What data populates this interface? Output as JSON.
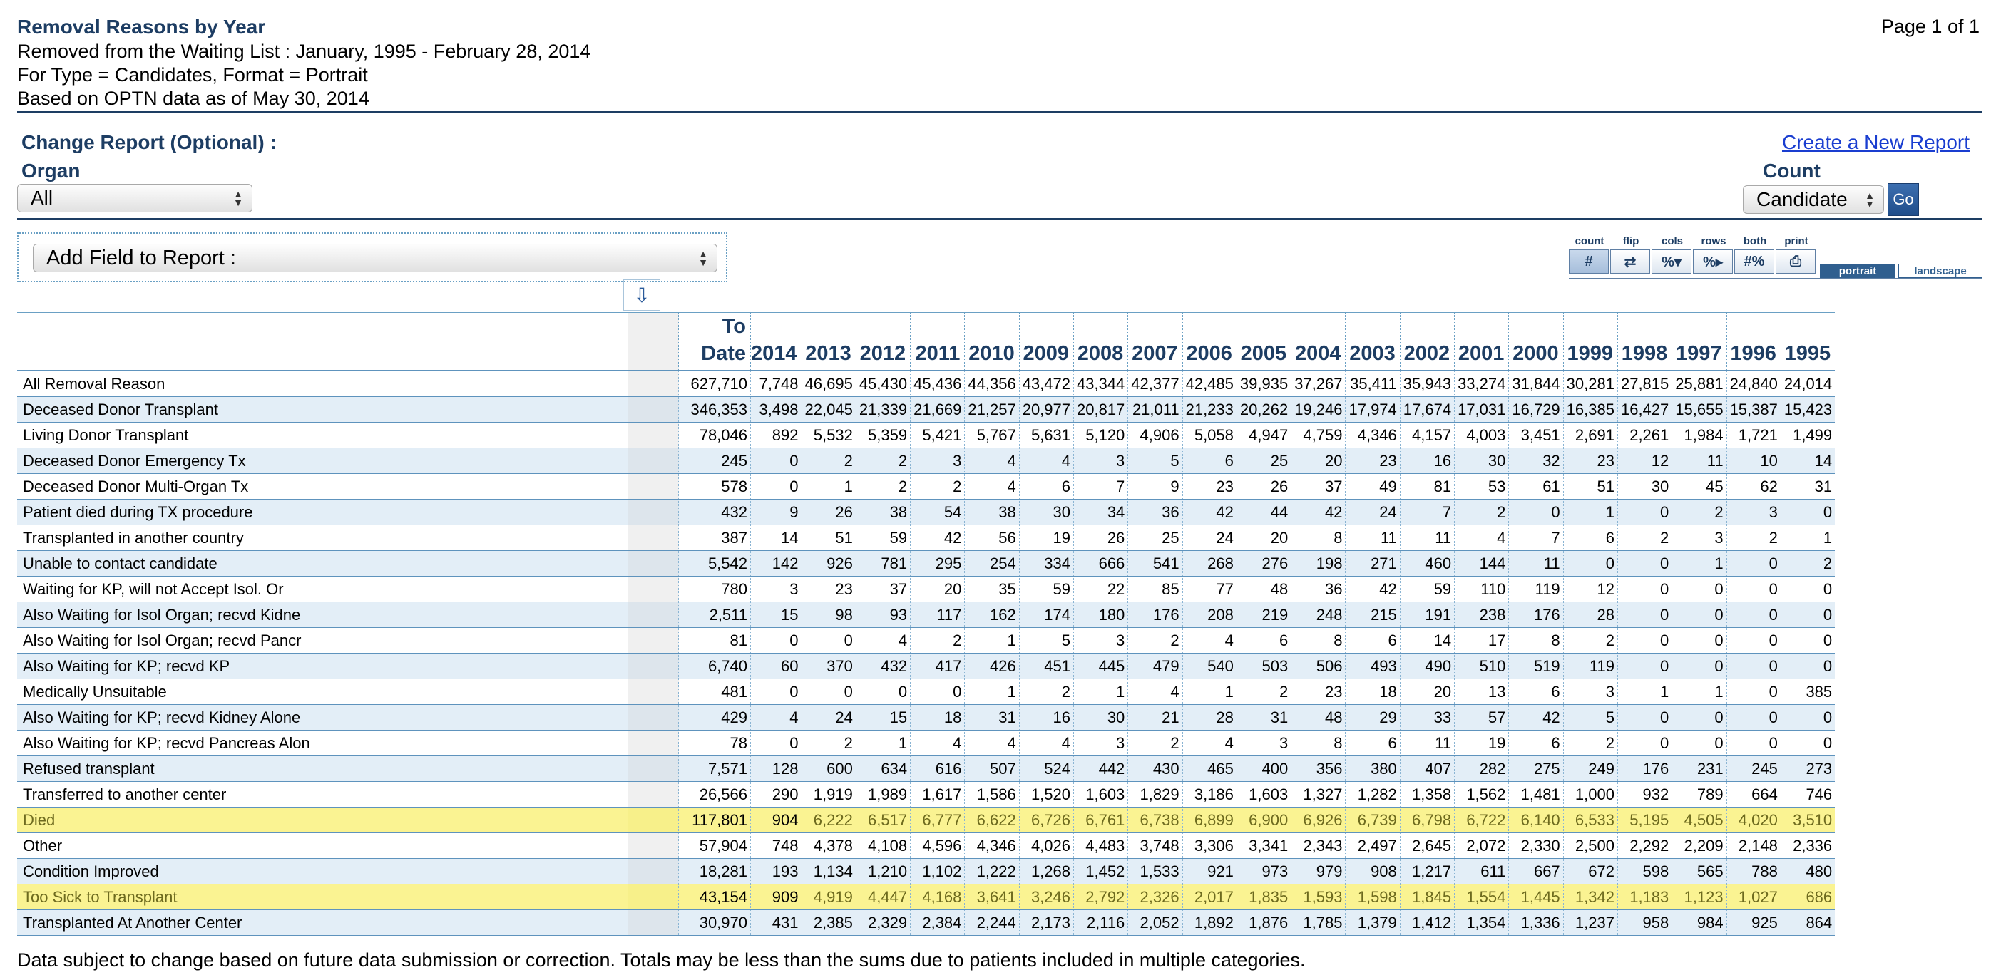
{
  "header": {
    "title": "Removal Reasons by Year",
    "lines": [
      "Removed from the Waiting List : January, 1995 - February 28, 2014",
      "For Type = Candidates, Format = Portrait",
      "Based on OPTN data as of May 30, 2014"
    ],
    "page_info": "Page 1 of 1"
  },
  "controls": {
    "change_report": "Change Report (Optional) :",
    "organ_label": "Organ",
    "organ_value": "All",
    "count_label": "Count",
    "count_value": "Candidate",
    "go_label": "Go",
    "new_report": "Create a New Report",
    "add_field": "Add Field to Report :"
  },
  "toolbar": {
    "labels": [
      "count",
      "flip",
      "cols",
      "rows",
      "both",
      "print"
    ],
    "symbols": [
      "#",
      "⇄",
      "%▾",
      "%▸",
      "#%",
      "⎙"
    ],
    "tabs": [
      "portrait",
      "landscape"
    ]
  },
  "table": {
    "headers": [
      "To Date",
      "2014",
      "2013",
      "2012",
      "2011",
      "2010",
      "2009",
      "2008",
      "2007",
      "2006",
      "2005",
      "2004",
      "2003",
      "2002",
      "2001",
      "2000",
      "1999",
      "1998",
      "1997",
      "1996",
      "1995"
    ],
    "rows": [
      {
        "label": "All Removal Reason",
        "values": [
          "627,710",
          "7,748",
          "46,695",
          "45,430",
          "45,436",
          "44,356",
          "43,472",
          "43,344",
          "42,377",
          "42,485",
          "39,935",
          "37,267",
          "35,411",
          "35,943",
          "33,274",
          "31,844",
          "30,281",
          "27,815",
          "25,881",
          "24,840",
          "24,014"
        ]
      },
      {
        "label": "Deceased Donor Transplant",
        "values": [
          "346,353",
          "3,498",
          "22,045",
          "21,339",
          "21,669",
          "21,257",
          "20,977",
          "20,817",
          "21,011",
          "21,233",
          "20,262",
          "19,246",
          "17,974",
          "17,674",
          "17,031",
          "16,729",
          "16,385",
          "16,427",
          "15,655",
          "15,387",
          "15,423"
        ]
      },
      {
        "label": "Living Donor Transplant",
        "values": [
          "78,046",
          "892",
          "5,532",
          "5,359",
          "5,421",
          "5,767",
          "5,631",
          "5,120",
          "4,906",
          "5,058",
          "4,947",
          "4,759",
          "4,346",
          "4,157",
          "4,003",
          "3,451",
          "2,691",
          "2,261",
          "1,984",
          "1,721",
          "1,499"
        ]
      },
      {
        "label": "Deceased Donor Emergency Tx",
        "values": [
          "245",
          "0",
          "2",
          "2",
          "3",
          "4",
          "4",
          "3",
          "5",
          "6",
          "25",
          "20",
          "23",
          "16",
          "30",
          "32",
          "23",
          "12",
          "11",
          "10",
          "14"
        ]
      },
      {
        "label": "Deceased Donor Multi-Organ Tx",
        "values": [
          "578",
          "0",
          "1",
          "2",
          "2",
          "4",
          "6",
          "7",
          "9",
          "23",
          "26",
          "37",
          "49",
          "81",
          "53",
          "61",
          "51",
          "30",
          "45",
          "62",
          "31"
        ]
      },
      {
        "label": "Patient died during TX procedure",
        "values": [
          "432",
          "9",
          "26",
          "38",
          "54",
          "38",
          "30",
          "34",
          "36",
          "42",
          "44",
          "42",
          "24",
          "7",
          "2",
          "0",
          "1",
          "0",
          "2",
          "3",
          "0"
        ]
      },
      {
        "label": "Transplanted in another country",
        "values": [
          "387",
          "14",
          "51",
          "59",
          "42",
          "56",
          "19",
          "26",
          "25",
          "24",
          "20",
          "8",
          "11",
          "11",
          "4",
          "7",
          "6",
          "2",
          "3",
          "2",
          "1"
        ]
      },
      {
        "label": "Unable to contact candidate",
        "values": [
          "5,542",
          "142",
          "926",
          "781",
          "295",
          "254",
          "334",
          "666",
          "541",
          "268",
          "276",
          "198",
          "271",
          "460",
          "144",
          "11",
          "0",
          "0",
          "1",
          "0",
          "2"
        ]
      },
      {
        "label": "Waiting for KP, will not Accept Isol. Or",
        "values": [
          "780",
          "3",
          "23",
          "37",
          "20",
          "35",
          "59",
          "22",
          "85",
          "77",
          "48",
          "36",
          "42",
          "59",
          "110",
          "119",
          "12",
          "0",
          "0",
          "0",
          "0"
        ]
      },
      {
        "label": "Also Waiting for Isol Organ; recvd Kidne",
        "values": [
          "2,511",
          "15",
          "98",
          "93",
          "117",
          "162",
          "174",
          "180",
          "176",
          "208",
          "219",
          "248",
          "215",
          "191",
          "238",
          "176",
          "28",
          "0",
          "0",
          "0",
          "0"
        ]
      },
      {
        "label": "Also Waiting for Isol Organ; recvd Pancr",
        "values": [
          "81",
          "0",
          "0",
          "4",
          "2",
          "1",
          "5",
          "3",
          "2",
          "4",
          "6",
          "8",
          "6",
          "14",
          "17",
          "8",
          "2",
          "0",
          "0",
          "0",
          "0"
        ]
      },
      {
        "label": "Also Waiting for KP; recvd KP",
        "values": [
          "6,740",
          "60",
          "370",
          "432",
          "417",
          "426",
          "451",
          "445",
          "479",
          "540",
          "503",
          "506",
          "493",
          "490",
          "510",
          "519",
          "119",
          "0",
          "0",
          "0",
          "0"
        ]
      },
      {
        "label": "Medically Unsuitable",
        "values": [
          "481",
          "0",
          "0",
          "0",
          "0",
          "1",
          "2",
          "1",
          "4",
          "1",
          "2",
          "23",
          "18",
          "20",
          "13",
          "6",
          "3",
          "1",
          "1",
          "0",
          "385"
        ]
      },
      {
        "label": "Also Waiting for KP; recvd Kidney Alone",
        "values": [
          "429",
          "4",
          "24",
          "15",
          "18",
          "31",
          "16",
          "30",
          "21",
          "28",
          "31",
          "48",
          "29",
          "33",
          "57",
          "42",
          "5",
          "0",
          "0",
          "0",
          "0"
        ]
      },
      {
        "label": "Also Waiting for KP; recvd Pancreas Alon",
        "values": [
          "78",
          "0",
          "2",
          "1",
          "4",
          "4",
          "4",
          "3",
          "2",
          "4",
          "3",
          "8",
          "6",
          "11",
          "19",
          "6",
          "2",
          "0",
          "0",
          "0",
          "0"
        ]
      },
      {
        "label": "Refused transplant",
        "values": [
          "7,571",
          "128",
          "600",
          "634",
          "616",
          "507",
          "524",
          "442",
          "430",
          "465",
          "400",
          "356",
          "380",
          "407",
          "282",
          "275",
          "249",
          "176",
          "231",
          "245",
          "273"
        ]
      },
      {
        "label": "Transferred to another center",
        "values": [
          "26,566",
          "290",
          "1,919",
          "1,989",
          "1,617",
          "1,586",
          "1,520",
          "1,603",
          "1,829",
          "3,186",
          "1,603",
          "1,327",
          "1,282",
          "1,358",
          "1,562",
          "1,481",
          "1,000",
          "932",
          "789",
          "664",
          "746"
        ]
      },
      {
        "label": "Died",
        "highlight": true,
        "values": [
          "117,801",
          "904",
          "6,222",
          "6,517",
          "6,777",
          "6,622",
          "6,726",
          "6,761",
          "6,738",
          "6,899",
          "6,900",
          "6,926",
          "6,739",
          "6,798",
          "6,722",
          "6,140",
          "6,533",
          "5,195",
          "4,505",
          "4,020",
          "3,510"
        ]
      },
      {
        "label": "Other",
        "values": [
          "57,904",
          "748",
          "4,378",
          "4,108",
          "4,596",
          "4,346",
          "4,026",
          "4,483",
          "3,748",
          "3,306",
          "3,341",
          "2,343",
          "2,497",
          "2,645",
          "2,072",
          "2,330",
          "2,500",
          "2,292",
          "2,209",
          "2,148",
          "2,336"
        ]
      },
      {
        "label": "Condition Improved",
        "values": [
          "18,281",
          "193",
          "1,134",
          "1,210",
          "1,102",
          "1,222",
          "1,268",
          "1,452",
          "1,533",
          "921",
          "973",
          "979",
          "908",
          "1,217",
          "611",
          "667",
          "672",
          "598",
          "565",
          "788",
          "480"
        ]
      },
      {
        "label": "Too Sick to Transplant",
        "highlight": true,
        "values": [
          "43,154",
          "909",
          "4,919",
          "4,447",
          "4,168",
          "3,641",
          "3,246",
          "2,792",
          "2,326",
          "2,017",
          "1,835",
          "1,593",
          "1,598",
          "1,845",
          "1,554",
          "1,445",
          "1,342",
          "1,183",
          "1,123",
          "1,027",
          "686"
        ]
      },
      {
        "label": "Transplanted At Another Center",
        "values": [
          "30,970",
          "431",
          "2,385",
          "2,329",
          "2,384",
          "2,244",
          "2,173",
          "2,116",
          "2,052",
          "1,892",
          "1,876",
          "1,785",
          "1,379",
          "1,412",
          "1,354",
          "1,336",
          "1,237",
          "958",
          "984",
          "925",
          "864"
        ]
      }
    ]
  },
  "footer": "Data subject to change based on future data submission or correction.  Totals may be less than the sums due to patients included in multiple categories."
}
